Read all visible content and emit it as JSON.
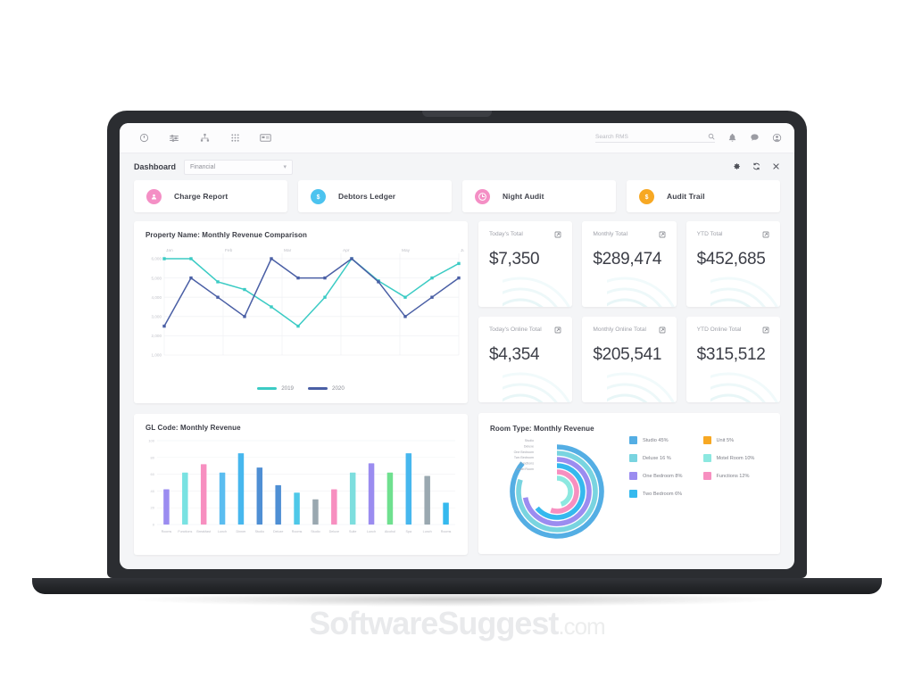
{
  "topbar": {
    "icons": [
      "power-icon",
      "filter-icon",
      "sitemap-icon",
      "grid-apps-icon",
      "card-icon"
    ],
    "search": {
      "placeholder": "Search RMS",
      "value": ""
    },
    "right_icons": [
      "search-icon",
      "bell-icon",
      "chat-icon",
      "account-icon"
    ]
  },
  "dashboard": {
    "title": "Dashboard",
    "selected_view": "Financial",
    "view_options": [
      "Financial"
    ],
    "actions": [
      "settings-icon",
      "refresh-icon",
      "close-icon"
    ]
  },
  "quick_actions": [
    {
      "label": "Charge Report",
      "icon": "person-icon",
      "color": "#f48fc5"
    },
    {
      "label": "Debtors Ledger",
      "icon": "dollar-icon",
      "color": "#4cc3ef"
    },
    {
      "label": "Night Audit",
      "icon": "clock-icon",
      "color": "#f48fc5"
    },
    {
      "label": "Audit Trail",
      "icon": "dollar-icon",
      "color": "#f7a823"
    }
  ],
  "stats": [
    {
      "label": "Today's Total",
      "value": "$7,350"
    },
    {
      "label": "Monthly Total",
      "value": "$289,474"
    },
    {
      "label": "YTD Total",
      "value": "$452,685"
    },
    {
      "label": "Today's Online Total",
      "value": "$4,354"
    },
    {
      "label": "Monthly Online Total",
      "value": "$205,541"
    },
    {
      "label": "YTD Online Total",
      "value": "$315,512"
    }
  ],
  "chart_data": [
    {
      "type": "line",
      "title": "Property Name: Monthly Revenue Comparison",
      "xlabel": "",
      "ylabel": "",
      "x": [
        "Jan",
        "",
        "Feb",
        "",
        "Mar",
        "",
        "Apr",
        "",
        "May",
        "",
        "Jun"
      ],
      "categories": [
        "Jan",
        "Feb",
        "Mar",
        "Apr",
        "May",
        "Jun"
      ],
      "ylim": [
        1000,
        6000
      ],
      "yticks": [
        6000,
        5000,
        4000,
        3000,
        2000,
        1000
      ],
      "grid": true,
      "legend_position": "bottom",
      "series": [
        {
          "name": "2019",
          "color": "#3bcbc4",
          "values": [
            6000,
            6000,
            4800,
            4400,
            3500,
            2500,
            4000,
            6000,
            4850,
            4000,
            5000,
            5750
          ]
        },
        {
          "name": "2020",
          "color": "#4a5fa5",
          "values": [
            2500,
            5000,
            4000,
            3000,
            6000,
            5000,
            5000,
            6000,
            4800,
            3000,
            4000,
            5000
          ]
        }
      ]
    },
    {
      "type": "bar",
      "title": "GL Code: Monthly Revenue",
      "xlabel": "",
      "ylabel": "",
      "ylim": [
        0,
        100
      ],
      "yticks": [
        100,
        80,
        60,
        40,
        20,
        0
      ],
      "grid": true,
      "categories": [
        "Rooms",
        "Functions",
        "Breakfast",
        "Lunch",
        "Dinner",
        "Studio",
        "Deluxe",
        "Rooms",
        "Studio",
        "Deluxe",
        "Suite",
        "Lunch",
        "Alcohol",
        "Spa",
        "Lunch",
        "Rooms"
      ],
      "values": [
        42,
        62,
        72,
        62,
        85,
        68,
        47,
        38,
        30,
        42,
        62,
        73,
        62,
        85,
        58,
        26
      ],
      "colors": [
        "#9b8cf0",
        "#79e2e2",
        "#f78fc0",
        "#5bbdf0",
        "#47b7ee",
        "#4f8fd4",
        "#4f8fd4",
        "#4ec8e8",
        "#9aa8b0",
        "#f78fc0",
        "#7ddede",
        "#9b8cf0",
        "#6fe08f",
        "#47b7ee",
        "#9aa8b0",
        "#35b9ee"
      ]
    },
    {
      "type": "pie",
      "subtype": "concentric-arcs",
      "title": "Room Type: Monthly Revenue",
      "labels": [
        "Studio",
        "Deluxe",
        "One Bedroom",
        "Two Bedroom",
        "Functions",
        "Motel Room"
      ],
      "legend": [
        {
          "label": "Studio 45%",
          "value": 45,
          "color": "#54aee4"
        },
        {
          "label": "Deluxe 16 %",
          "value": 16,
          "color": "#79d4e0"
        },
        {
          "label": "One Bedroom 8%",
          "value": 8,
          "color": "#9b8cf0"
        },
        {
          "label": "Two Bedroom 6%",
          "value": 6,
          "color": "#35b9ee"
        },
        {
          "label": "Unit 5%",
          "value": 5,
          "color": "#f7a823"
        },
        {
          "label": "Motel Room 10%",
          "value": 10,
          "color": "#8ce8e0"
        },
        {
          "label": "Functions 12%",
          "value": 12,
          "color": "#f78fc0"
        }
      ]
    }
  ],
  "watermark": {
    "brand": "SoftwareSuggest",
    "tld": ".com"
  }
}
